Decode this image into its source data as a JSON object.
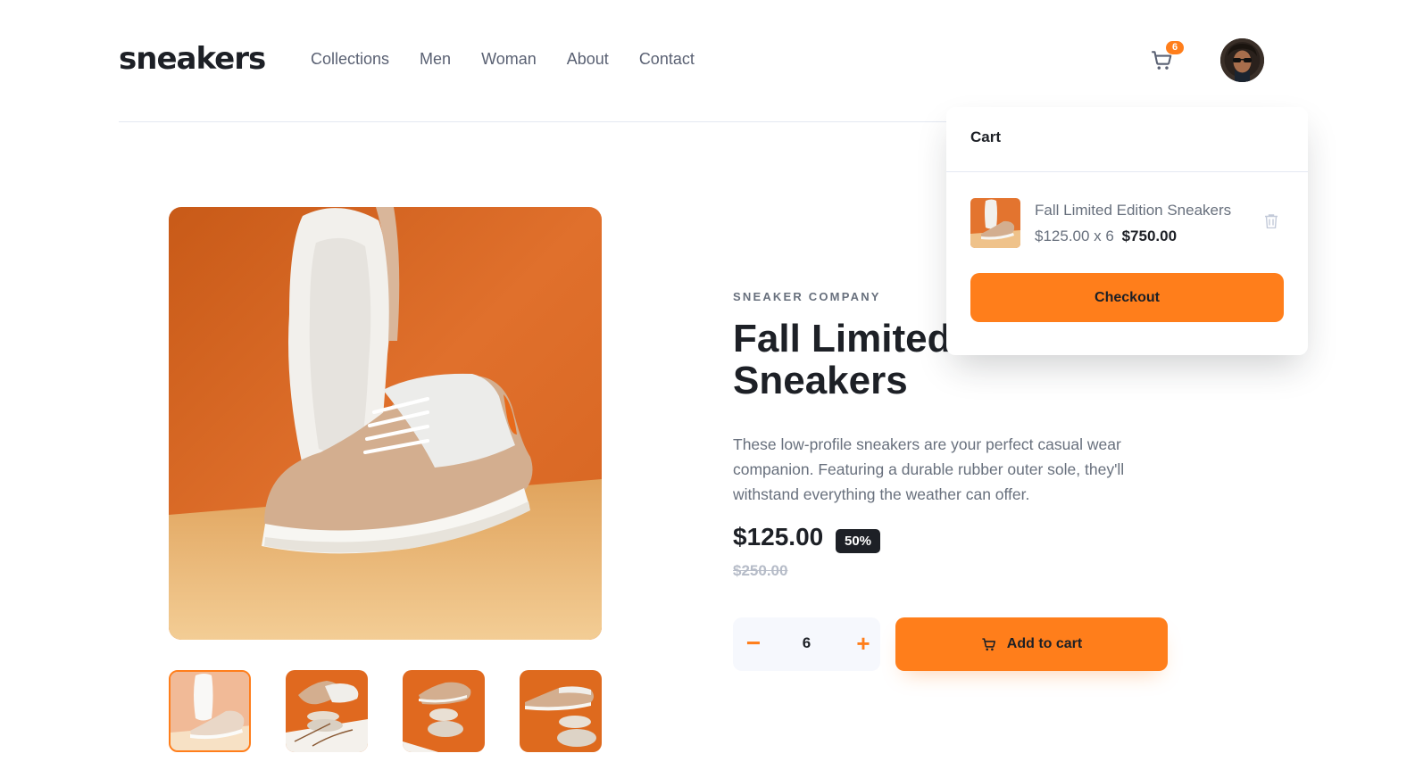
{
  "header": {
    "logo": "sneakers",
    "nav": [
      "Collections",
      "Men",
      "Woman",
      "About",
      "Contact"
    ],
    "cart_count": "6",
    "cart_icon": "cart-icon",
    "avatar": "user-avatar"
  },
  "gallery": {
    "main_image": "white-tan-sneaker-orange-background",
    "thumbnails": [
      "sneaker-sole-up",
      "sneaker-on-stones-leaves",
      "sneaker-balanced-on-stones",
      "sneaker-on-stones-side"
    ],
    "active_thumbnail": 0
  },
  "product": {
    "company": "SNEAKER COMPANY",
    "title": "Fall Limited Edition Sneakers",
    "description": "These low-profile sneakers are your perfect casual wear companion. Featuring a durable rubber outer sole, they'll withstand everything the weather can offer.",
    "price": "$125.00",
    "discount": "50%",
    "old_price": "$250.00",
    "quantity": "6",
    "minus_label": "−",
    "plus_label": "+",
    "add_to_cart": "Add to cart"
  },
  "cart": {
    "title": "Cart",
    "item": {
      "name": "Fall Limited Edition Sneakers",
      "unit_qty": "$125.00 x 6",
      "total": "$750.00"
    },
    "checkout": "Checkout"
  },
  "colors": {
    "accent": "#ff7e1b",
    "dark": "#1d2026",
    "muted": "#68707d"
  }
}
